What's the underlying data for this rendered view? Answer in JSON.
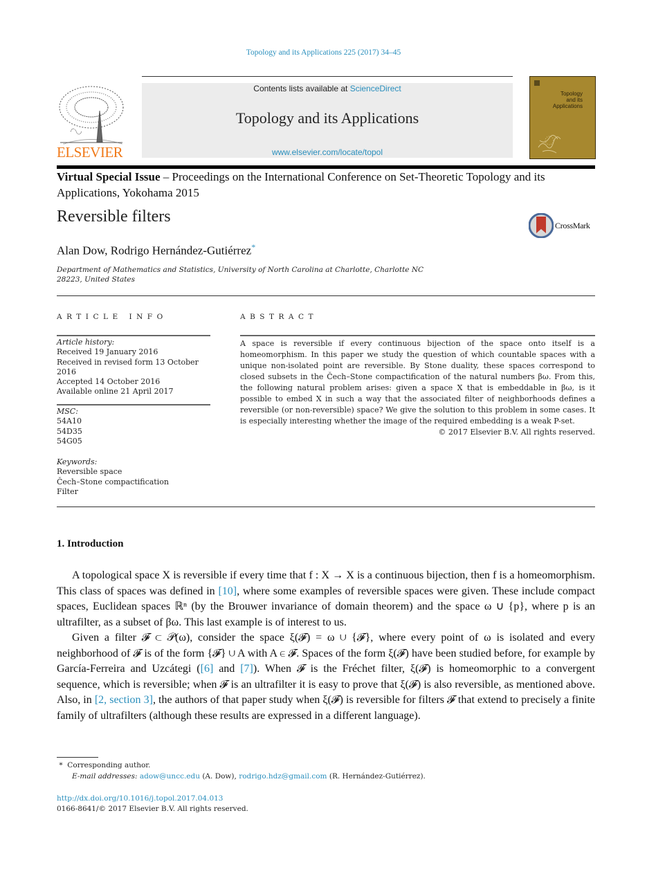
{
  "header": {
    "journal_ref": "Topology and its Applications 225 (2017) 34–45",
    "contents_prefix": "Contents lists available at ",
    "contents_link": "ScienceDirect",
    "journal_title": "Topology and its Applications",
    "journal_url": "www.elsevier.com/locate/topol",
    "publisher_logo_text": "ELSEVIER",
    "cover_title_lines": [
      "Topology",
      "and its",
      "Applications"
    ]
  },
  "special_issue": {
    "label": "Virtual Special Issue",
    "text": " – Proceedings on the International Conference on Set-Theoretic Topology and its Applications, Yokohama 2015"
  },
  "article": {
    "title": "Reversible filters",
    "crossmark_label": "CrossMark",
    "authors": "Alan Dow, Rodrigo Hernández-Gutiérrez",
    "corresponding_marker": "*",
    "affiliation_line1": "Department of Mathematics and Statistics, University of North Carolina at Charlotte, Charlotte NC",
    "affiliation_line2": "28223, United States"
  },
  "article_info": {
    "heading": "ARTICLE INFO",
    "history_label": "Article history:",
    "history": [
      "Received 19 January 2016",
      "Received in revised form 13 October 2016",
      "Accepted 14 October 2016",
      "Available online 21 April 2017"
    ],
    "msc_label": "MSC:",
    "msc": [
      "54A10",
      "54D35",
      "54G05"
    ],
    "keywords_label": "Keywords:",
    "keywords": [
      "Reversible space",
      "Čech–Stone compactification",
      "Filter"
    ]
  },
  "abstract": {
    "heading": "ABSTRACT",
    "text": "A space is reversible if every continuous bijection of the space onto itself is a homeomorphism. In this paper we study the question of which countable spaces with a unique non-isolated point are reversible. By Stone duality, these spaces correspond to closed subsets in the Čech–Stone compactification of the natural numbers βω. From this, the following natural problem arises: given a space X that is embeddable in βω, is it possible to embed X in such a way that the associated filter of neighborhoods defines a reversible (or non-reversible) space? We give the solution to this problem in some cases. It is especially interesting whether the image of the required embedding is a weak P-set.",
    "copyright": "© 2017 Elsevier B.V. All rights reserved."
  },
  "section1": {
    "heading": "1. Introduction",
    "p1_a": "A topological space X is reversible if every time that f : X → X is a continuous bijection, then f is a homeomorphism. This class of spaces was defined in ",
    "p1_ref": "[10]",
    "p1_b": ", where some examples of reversible spaces were given. These include compact spaces, Euclidean spaces ℝⁿ (by the Brouwer invariance of domain theorem) and the space ω ∪ {p}, where p is an ultrafilter, as a subset of βω. This last example is of interest to us.",
    "p2_a": "Given a filter 𝓕 ⊂ 𝒫(ω), consider the space ξ(𝓕) = ω ∪ {𝓕}, where every point of ω is isolated and every neighborhood of 𝓕 is of the form {𝓕} ∪ A with A ∈ 𝓕. Spaces of the form ξ(𝓕) have been studied before, for example by García-Ferreira and Uzcátegi (",
    "p2_ref1": "[6]",
    "p2_mid": " and ",
    "p2_ref2": "[7]",
    "p2_b": "). When 𝓕 is the Fréchet filter, ξ(𝓕) is homeomorphic to a convergent sequence, which is reversible; when 𝓕 is an ultrafilter it is easy to prove that ξ(𝓕) is also reversible, as mentioned above. Also, in ",
    "p2_ref3": "[2, section 3]",
    "p2_c": ", the authors of that paper study when ξ(𝓕) is reversible for filters 𝓕 that extend to precisely a finite family of ultrafilters (although these results are expressed in a different language)."
  },
  "footnotes": {
    "marker": "*",
    "corresponding": "Corresponding author.",
    "email_label": "E-mail addresses:",
    "email1": "adow@uncc.edu",
    "email1_name": " (A. Dow), ",
    "email2": "rodrigo.hdz@gmail.com",
    "email2_name": " (R. Hernández-Gutiérrez)."
  },
  "bottom": {
    "doi": "http://dx.doi.org/10.1016/j.topol.2017.04.013",
    "issn_copyright": "0166-8641/© 2017 Elsevier B.V. All rights reserved."
  }
}
